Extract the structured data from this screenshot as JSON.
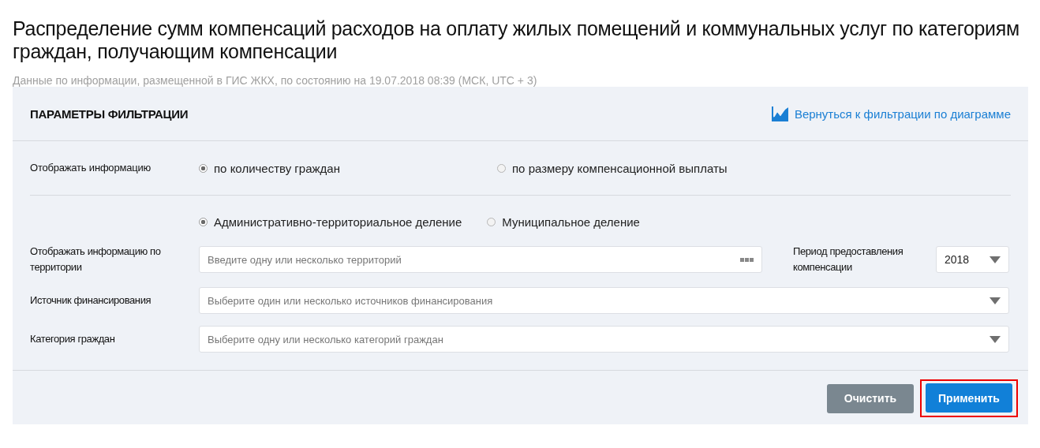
{
  "title": "Распределение сумм компенсаций расходов на оплату жилых помещений и коммунальных услуг по категориям граждан, получающим компенсации",
  "subtitle": "Данные по информации, размещенной в ГИС ЖКХ, по состоянию на 19.07.2018 08:39 (МСК, UTC + 3)",
  "panel": {
    "heading": "ПАРАМЕТРЫ ФИЛЬТРАЦИИ",
    "back_link": "Вернуться к фильтрации по диаграмме"
  },
  "display_mode": {
    "label": "Отображать информацию",
    "options": [
      {
        "label": "по количеству граждан",
        "selected": true
      },
      {
        "label": "по размеру компенсационной выплаты",
        "selected": false
      }
    ]
  },
  "division": {
    "options": [
      {
        "label": "Административно-территориальное деление",
        "selected": true
      },
      {
        "label": "Муниципальное деление",
        "selected": false
      }
    ]
  },
  "territory": {
    "label": "Отображать информацию по территории",
    "placeholder": "Введите одну или несколько территорий"
  },
  "period": {
    "label": "Период предоставления компенсации",
    "value": "2018"
  },
  "source": {
    "label": "Источник финансирования",
    "placeholder": "Выберите один или несколько источников финансирования"
  },
  "category": {
    "label": "Категория граждан",
    "placeholder": "Выберите одну или несколько категорий граждан"
  },
  "buttons": [
    {
      "label": "Очистить",
      "kind": "secondary",
      "highlighted": false
    },
    {
      "label": "Применить",
      "kind": "primary",
      "highlighted": true
    }
  ]
}
